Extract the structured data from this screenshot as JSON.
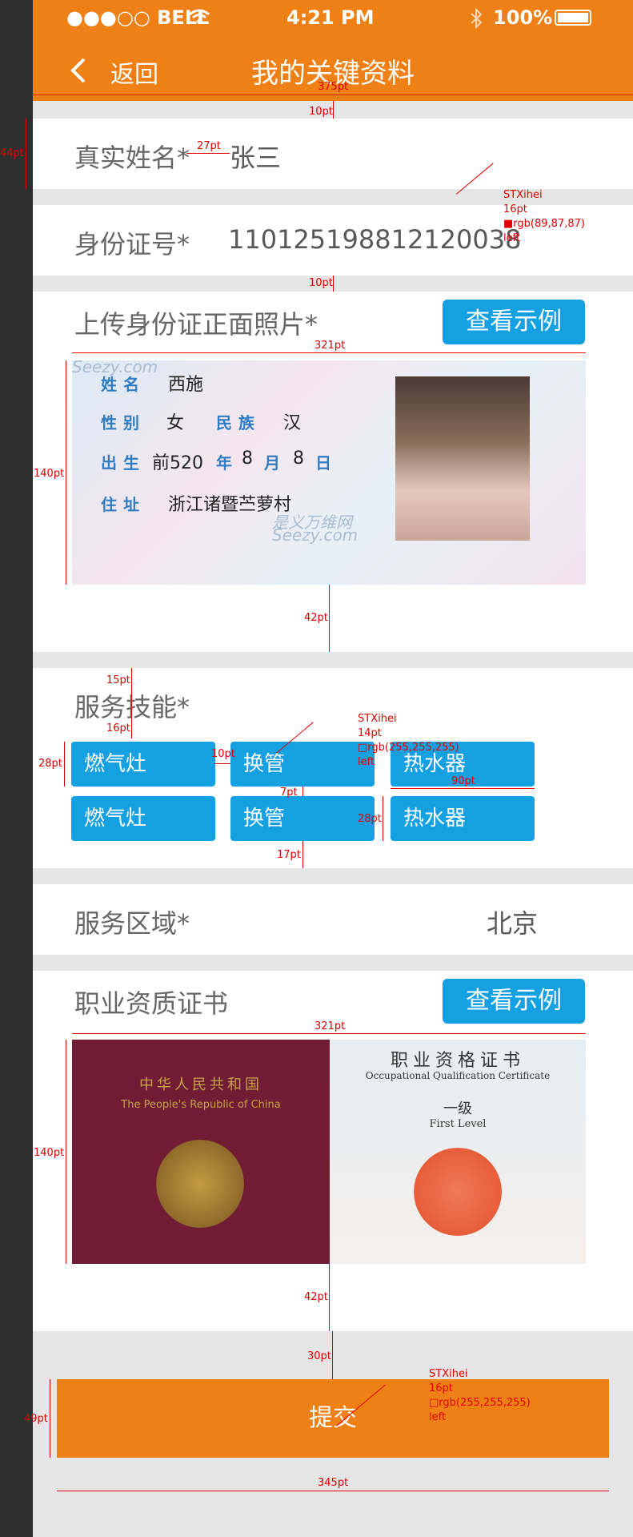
{
  "status": {
    "carrier": "●●●○○ BELL",
    "wifi_icon": "wifi-icon",
    "time": "4:21 PM",
    "bluetooth_icon": "bluetooth-icon",
    "battery": "100%"
  },
  "nav": {
    "back_label": "返回",
    "title": "我的关键资料"
  },
  "fields": {
    "name_label": "真实姓名*",
    "name_value": "张三",
    "id_label": "身份证号*",
    "id_value": "110125198812120038",
    "upload_label": "上传身份证正面照片*",
    "view_example": "查看示例",
    "skills_label": "服务技能*",
    "skills": [
      "燃气灶",
      "换管",
      "热水器",
      "燃气灶",
      "换管",
      "热水器"
    ],
    "area_label": "服务区域*",
    "area_value": "北京",
    "cert_label": "职业资质证书",
    "cert_view_example": "查看示例",
    "submit_label": "提交"
  },
  "idcard": {
    "name_field": "姓名",
    "name": "西施",
    "sex_field": "性别",
    "sex": "女",
    "nation_field": "民族",
    "nation": "汉",
    "birth_field": "出生",
    "birth_year": "前520",
    "year_unit": "年",
    "birth_month": "8",
    "month_unit": "月",
    "birth_day": "8",
    "day_unit": "日",
    "address_field": "住址",
    "address": "浙江诸暨苎萝村",
    "watermark_top": "Seezy.com",
    "watermark_cn": "是义万维网",
    "watermark_bottom": "Seezy.com"
  },
  "certificate": {
    "left_cn": "中华人民共和国",
    "left_en": "The People's Republic of China",
    "right_cn": "职业资格证书",
    "right_en": "Occupational Qualification Certificate",
    "level_cn": "一级",
    "level_en": "First Level"
  },
  "annotations": {
    "width_375": "375pt",
    "gap_10a": "10pt",
    "h_44": "44pt",
    "gap_27": "27pt",
    "font_note1": [
      "STXihei",
      "16pt",
      "■rgb(89,87,87)",
      "left"
    ],
    "gap_10b": "10pt",
    "width_321a": "321pt",
    "h_140a": "140pt",
    "gap_42a": "42pt",
    "gap_15": "15pt",
    "gap_16": "16pt",
    "h_28a": "28pt",
    "gap_10c": "10pt",
    "font_note2": [
      "STXihei",
      "14pt",
      "□rgb(255,255,255)",
      "left"
    ],
    "gap_7": "7pt",
    "w_90": "90pt",
    "h_28b": "28pt",
    "gap_17": "17pt",
    "width_321b": "321pt",
    "h_140b": "140pt",
    "gap_42b": "42pt",
    "gap_30": "30pt",
    "h_49": "49pt",
    "font_note3": [
      "STXihei",
      "16pt",
      "□rgb(255,255,255)",
      "left"
    ],
    "width_345": "345pt"
  }
}
